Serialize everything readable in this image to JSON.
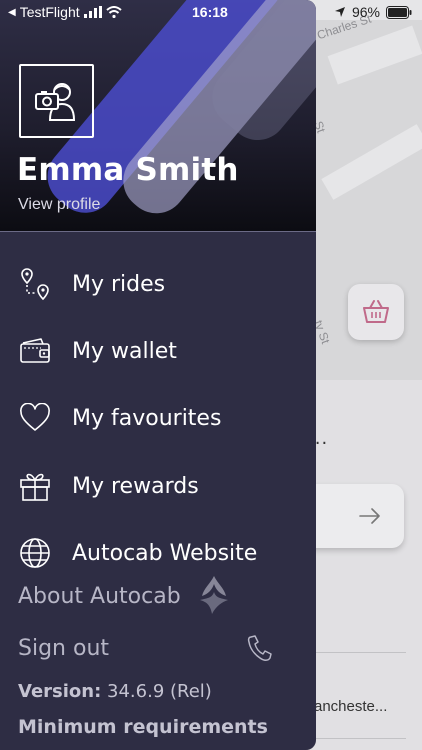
{
  "status_bar": {
    "back_app": "TestFlight",
    "time": "16:18",
    "battery": "96%"
  },
  "map": {
    "street_charles": "Charles St",
    "street_st1": "St",
    "street_st2": "ty St",
    "dots": "...",
    "address_snippet": "ancheste..."
  },
  "drawer": {
    "user_name": "Emma Smith",
    "view_profile": "View profile",
    "menu": [
      {
        "label": "My rides",
        "icon": "route-pin-icon"
      },
      {
        "label": "My wallet",
        "icon": "wallet-icon"
      },
      {
        "label": "My favourites",
        "icon": "heart-icon"
      },
      {
        "label": "My rewards",
        "icon": "gift-icon"
      },
      {
        "label": "Autocab Website",
        "icon": "globe-icon"
      }
    ],
    "about": "About Autocab",
    "sign_out": "Sign out",
    "version_label": "Version:",
    "version_value": "34.6.9 (Rel)",
    "min_requirements": "Minimum requirements"
  }
}
